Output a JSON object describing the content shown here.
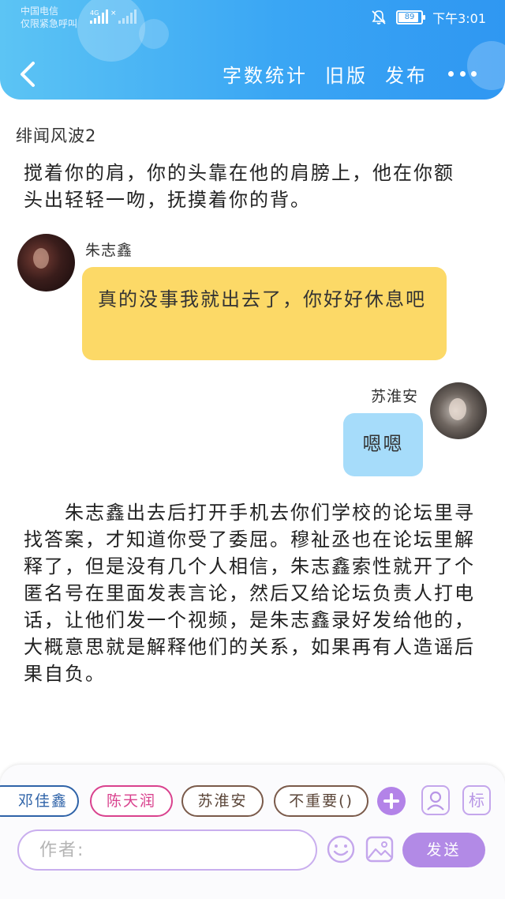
{
  "status_bar": {
    "carrier": "中国电信",
    "emergency": "仅限紧急呼叫",
    "network": "4G",
    "battery": "89",
    "time": "下午3:01"
  },
  "header": {
    "actions": {
      "word_count": "字数统计",
      "old_version": "旧版",
      "publish": "发布"
    },
    "icons": [
      "back-arrow",
      "more-dots"
    ]
  },
  "story": {
    "title": "绯闻风波2",
    "paragraph1": "搅着你的肩，你的头靠在他的肩膀上，他在你额头出轻轻一吻，抚摸着你的背。",
    "paragraph2": "　　朱志鑫出去后打开手机去你们学校的论坛里寻找答案，才知道你受了委屈。穆祉丞也在论坛里解释了，但是没有几个人相信，朱志鑫索性就开了个匿名号在里面发表言论，然后又给论坛负责人打电话，让他们发一个视频，是朱志鑫录好发给他的，大概意思就是解释他们的关系，如果再有人造谣后果自负。"
  },
  "chat": {
    "left": {
      "speaker": "朱志鑫",
      "message": "真的没事我就出去了，你好好休息吧"
    },
    "right": {
      "speaker": "苏淮安",
      "message": "嗯嗯"
    }
  },
  "bottom_bar": {
    "roles": [
      "邓佳鑫",
      "陈天润",
      "苏淮安",
      "不重要()"
    ],
    "tag_icon_label": "标",
    "author_placeholder": "作者:",
    "send_label": "发送"
  },
  "colors": {
    "header": "#3aa6f4",
    "yellow_bubble": "#fcd967",
    "blue_bubble": "#a6dcfa",
    "accent_purple": "#b383e8"
  }
}
